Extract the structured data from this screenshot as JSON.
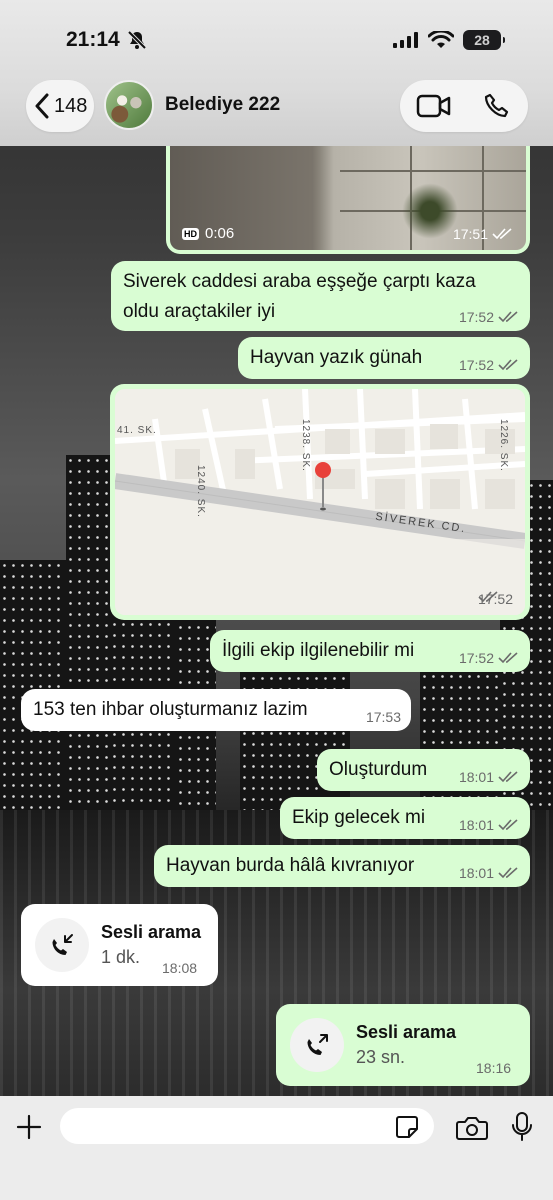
{
  "status_bar": {
    "time": "21:14",
    "battery": "28"
  },
  "header": {
    "back_count": "148",
    "contact_name": "Belediye 222"
  },
  "messages": {
    "video": {
      "duration": "0:06",
      "hd": "HD",
      "time": "17:51"
    },
    "m1": {
      "text": "Siverek caddesi araba eşşeğe çarptı kaza oldu araçtakiler iyi",
      "time": "17:52"
    },
    "m2": {
      "text": "Hayvan yazık günah",
      "time": "17:52"
    },
    "map": {
      "time": "17:52",
      "labels": {
        "sk41": "41. SK.",
        "sk1240": "1240. SK.",
        "sk1238": "1238. SK.",
        "sk1226": "1226. SK.",
        "siverek": "SİVEREK CD."
      }
    },
    "m3": {
      "text": "İlgili ekip ilgilenebilir mi",
      "time": "17:52"
    },
    "m4": {
      "text": "153 ten ihbar oluşturmanız lazim",
      "time": "17:53"
    },
    "m5": {
      "text": "Oluşturdum",
      "time": "18:01"
    },
    "m6": {
      "text": "Ekip gelecek mi",
      "time": "18:01"
    },
    "m7": {
      "text": "Hayvan burda hâlâ kıvranıyor",
      "time": "18:01"
    },
    "call_in": {
      "title": "Sesli arama",
      "duration": "1 dk.",
      "time": "18:08"
    },
    "call_out": {
      "title": "Sesli arama",
      "duration": "23 sn.",
      "time": "18:16"
    }
  },
  "composer": {
    "placeholder": ""
  },
  "colors": {
    "outgoing": "#d9fdd3",
    "incoming": "#ffffff",
    "read_ticks": "#6b6b6b"
  }
}
